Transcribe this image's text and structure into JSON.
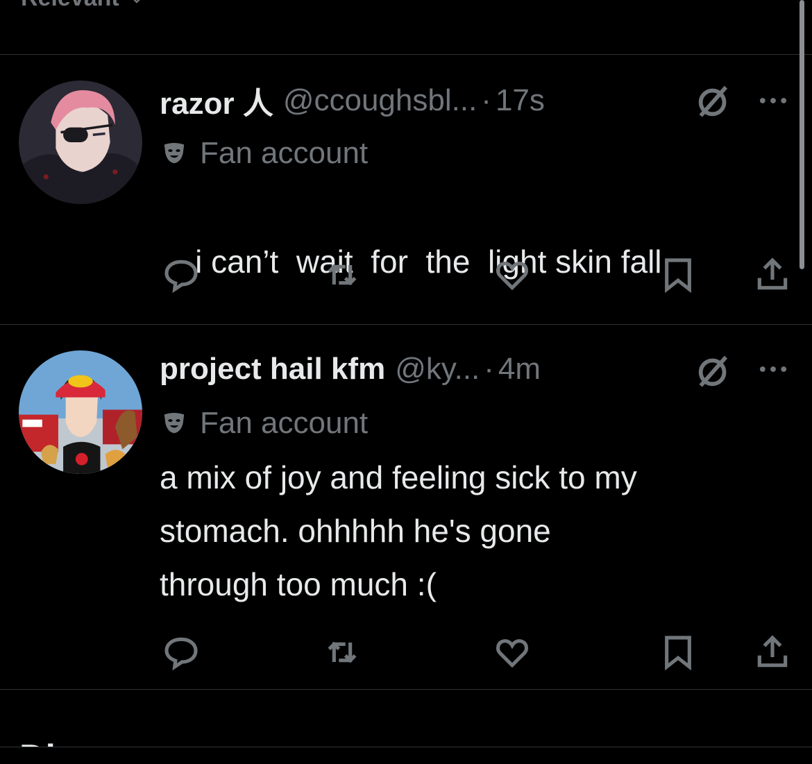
{
  "header": {
    "sort_label": "Relevant"
  },
  "tweets": [
    {
      "display_name": "razor 人",
      "handle": "@ccoughsbl...",
      "separator": "·",
      "time": "17s",
      "badge_label": "Fan account",
      "text": "i can’t  wait  for  the  light skin fall"
    },
    {
      "display_name": "project hail kfm",
      "handle": "@ky...",
      "separator": "·",
      "time": "4m",
      "badge_label": "Fan account",
      "text_lines": [
        "a mix of joy and feeling sick to my",
        "stomach. ohhhhh he's gone",
        "through too much :("
      ]
    }
  ],
  "bottom_partial_heading": "Di",
  "colors": {
    "background": "#000000",
    "primary_text": "#e7e9ea",
    "secondary_text": "#71767b",
    "divider": "#2f3336"
  }
}
